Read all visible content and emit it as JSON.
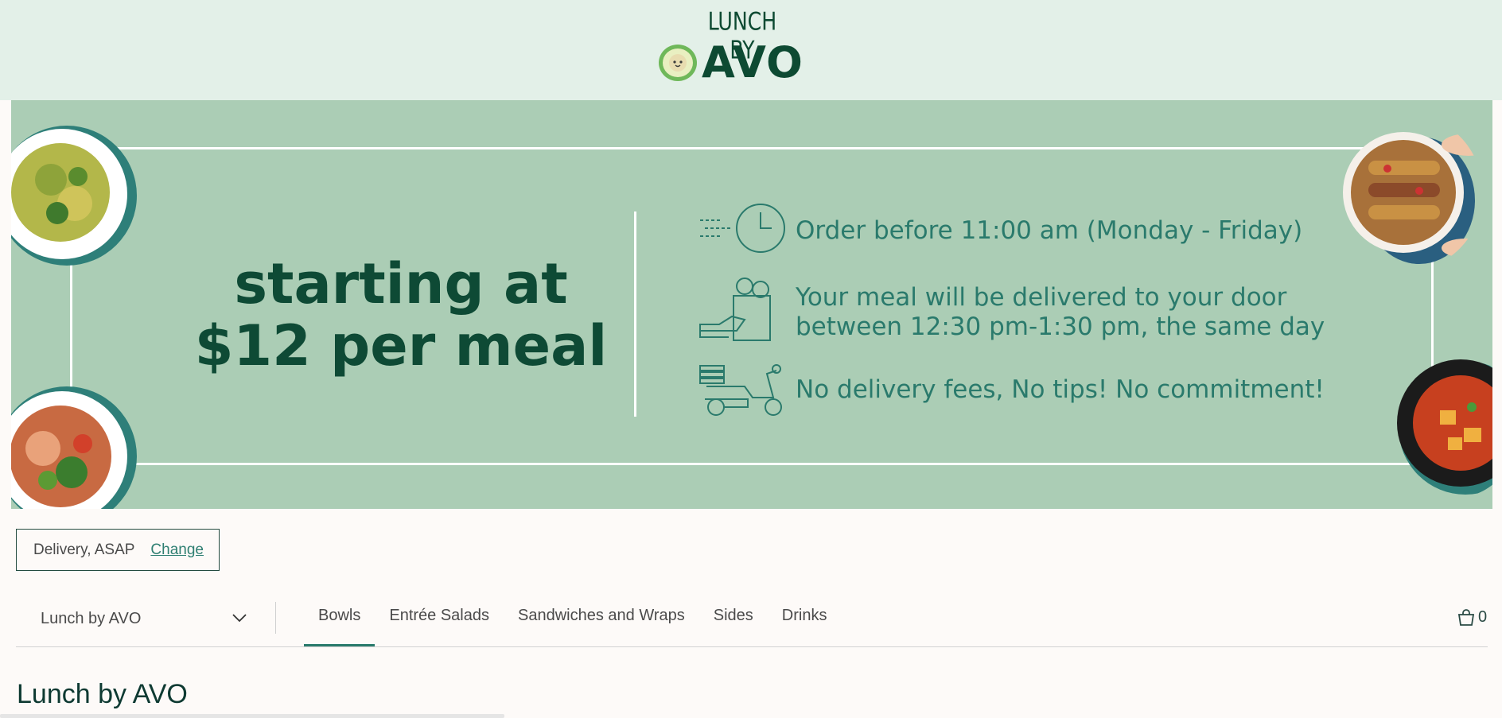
{
  "brand": {
    "logo_top": "Lunch by",
    "logo_name": "AVO"
  },
  "banner": {
    "headline_line1": "starting at",
    "headline_line2": "$12 per meal",
    "features": [
      {
        "icon": "clock-icon",
        "text_line1": "Order before 11:00 am (Monday - Friday)",
        "text_line2": ""
      },
      {
        "icon": "delivery-bag-icon",
        "text_line1": "Your meal will be delivered to your door",
        "text_line2": "between 12:30 pm-1:30 pm, the same day"
      },
      {
        "icon": "scooter-icon",
        "text_line1": "No delivery fees, No tips! No commitment!",
        "text_line2": ""
      }
    ],
    "colors": {
      "background": "#abcdb5",
      "headline": "#0e4a35",
      "feature_text": "#2a7a6c"
    }
  },
  "delivery": {
    "label": "Delivery, ASAP",
    "change_link": "Change"
  },
  "menu": {
    "selected": "Lunch by AVO",
    "tabs": [
      "Bowls",
      "Entrée Salads",
      "Sandwiches and Wraps",
      "Sides",
      "Drinks"
    ],
    "active_tab": "Bowls",
    "cart_count": "0"
  },
  "section": {
    "title": "Lunch by AVO"
  }
}
